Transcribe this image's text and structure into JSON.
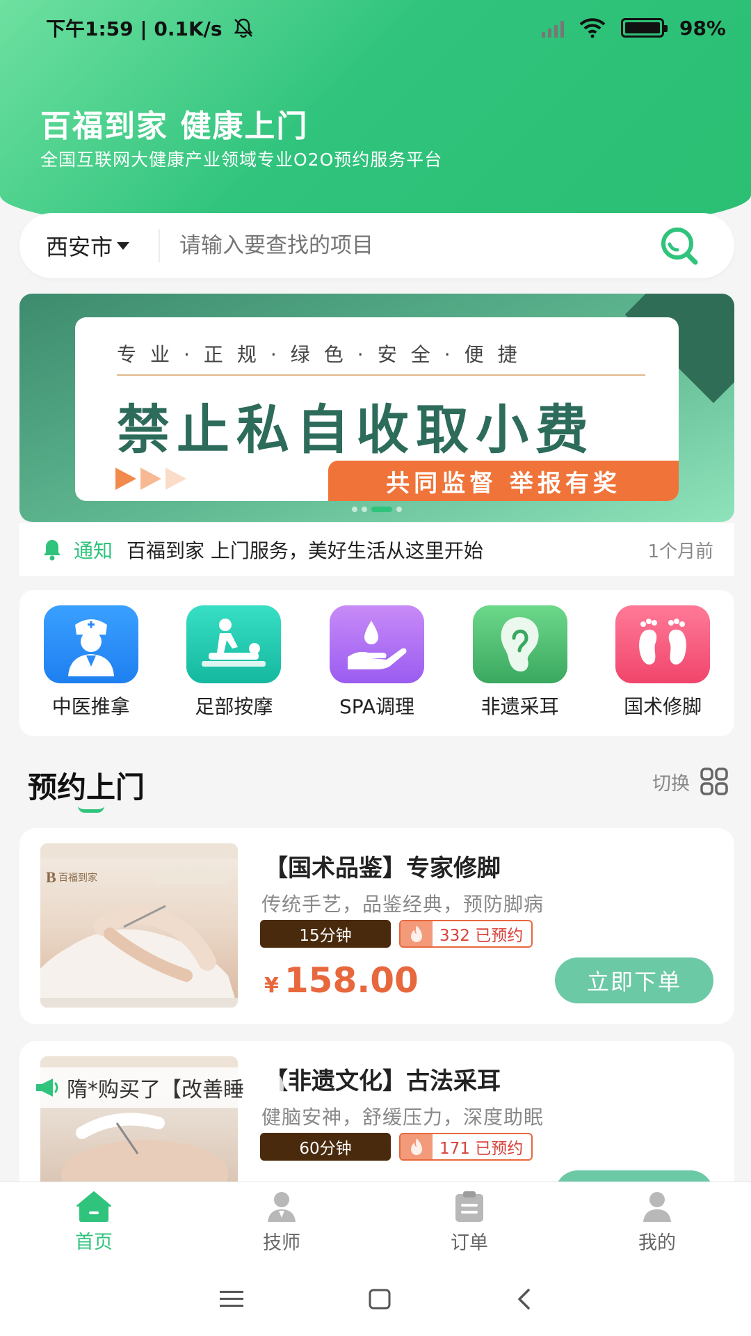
{
  "status_bar": {
    "time_speed": "下午1:59 | 0.1K/s",
    "battery": "98%"
  },
  "header": {
    "title": "百福到家 健康上门",
    "subtitle": "全国互联网大健康产业领域专业O2O预约服务平台"
  },
  "search": {
    "city": "西安市",
    "placeholder": "请输入要查找的项目"
  },
  "banner": {
    "tagline": "专业·正规·绿色·安全·便捷",
    "headline": "禁止私自收取小费",
    "pill": "共同监督 举报有奖"
  },
  "notice": {
    "tag": "通知",
    "text": "百福到家 上门服务，美好生活从这里开始",
    "time": "1个月前"
  },
  "categories": [
    {
      "label": "中医推拿",
      "icon": "doctor-icon"
    },
    {
      "label": "足部按摩",
      "icon": "massage-icon"
    },
    {
      "label": "SPA调理",
      "icon": "spa-hand-icon"
    },
    {
      "label": "非遗采耳",
      "icon": "ear-icon"
    },
    {
      "label": "国术修脚",
      "icon": "feet-icon"
    }
  ],
  "section": {
    "title": "预约上门",
    "switch_label": "切换"
  },
  "services": [
    {
      "title": "【国术品鉴】专家修脚",
      "desc": "传统手艺，品鉴经典，预防脚病",
      "duration": "15分钟",
      "booked": "332 已预约",
      "currency": "¥",
      "price": "158.00",
      "button": "立即下单",
      "img_brand": "百福到家"
    },
    {
      "title": "【非遗文化】古法采耳",
      "desc": "健脑安神，舒缓压力，深度助眠",
      "duration": "60分钟",
      "booked": "171 已预约"
    }
  ],
  "toast": {
    "text": "隋*购买了【改善睡"
  },
  "tabbar": [
    {
      "label": "首页",
      "icon": "home-icon",
      "active": true
    },
    {
      "label": "技师",
      "icon": "technician-icon"
    },
    {
      "label": "订单",
      "icon": "order-icon"
    },
    {
      "label": "我的",
      "icon": "profile-icon"
    }
  ],
  "colors": {
    "brand_green": "#2fc37c",
    "price_orange": "#e8683d",
    "button_green": "#6cc9a6"
  }
}
